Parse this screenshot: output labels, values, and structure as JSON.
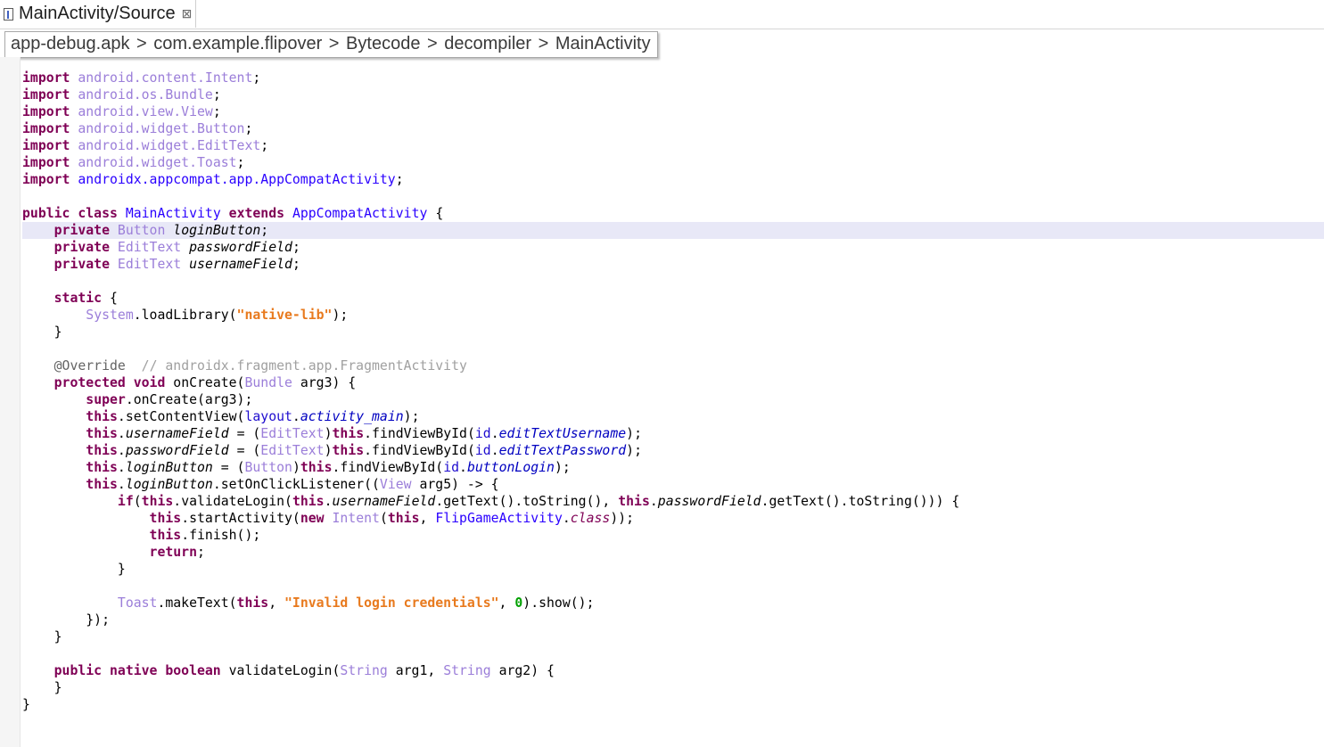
{
  "tab": {
    "title": "MainActivity/Source",
    "close": "⊠",
    "icon": "java-source-file-icon"
  },
  "breadcrumb": [
    "app-debug.apk",
    "com.example.flipover",
    "Bytecode",
    "decompiler",
    "MainActivity"
  ],
  "breadcrumb_separator": ">",
  "code": {
    "imports": [
      {
        "kw": "import",
        "pkg": "android.content.Intent",
        "end": ";"
      },
      {
        "kw": "import",
        "pkg": "android.os.Bundle",
        "end": ";"
      },
      {
        "kw": "import",
        "pkg": "android.view.View",
        "end": ";"
      },
      {
        "kw": "import",
        "pkg": "android.widget.Button",
        "end": ";"
      },
      {
        "kw": "import",
        "pkg": "android.widget.EditText",
        "end": ";"
      },
      {
        "kw": "import",
        "pkg": "android.widget.Toast",
        "end": ";"
      },
      {
        "kw": "import",
        "pkg": "androidx.appcompat.app.AppCompatActivity",
        "end": ";"
      }
    ],
    "class_decl": {
      "kw": "public class",
      "name": "MainActivity",
      "kw2": "extends",
      "super": "AppCompatActivity",
      "brace": "{"
    },
    "fields": [
      {
        "kw": "private",
        "type": "Button",
        "name": "loginButton"
      },
      {
        "kw": "private",
        "type": "EditText",
        "name": "passwordField"
      },
      {
        "kw": "private",
        "type": "EditText",
        "name": "usernameField"
      }
    ],
    "static_block": {
      "kw": "static",
      "cls": "System",
      "call": ".loadLibrary(",
      "arg": "\"native-lib\"",
      "end": ");"
    },
    "annotation": "@Override",
    "annotation_comment": "// androidx.fragment.app.FragmentActivity",
    "oncreate_sig": {
      "kw": "protected void",
      "name": "onCreate(",
      "type": "Bundle",
      "param": "arg3) {"
    },
    "toast": {
      "cls": "Toast",
      "call": ".makeText(",
      "str": "\"Invalid login credentials\"",
      "num": "0",
      "end": ").show();"
    },
    "native_sig": {
      "kw": "public native boolean",
      "name": "validateLogin(",
      "type": "String",
      "p1": "arg1, ",
      "p2": "arg2) {"
    }
  }
}
